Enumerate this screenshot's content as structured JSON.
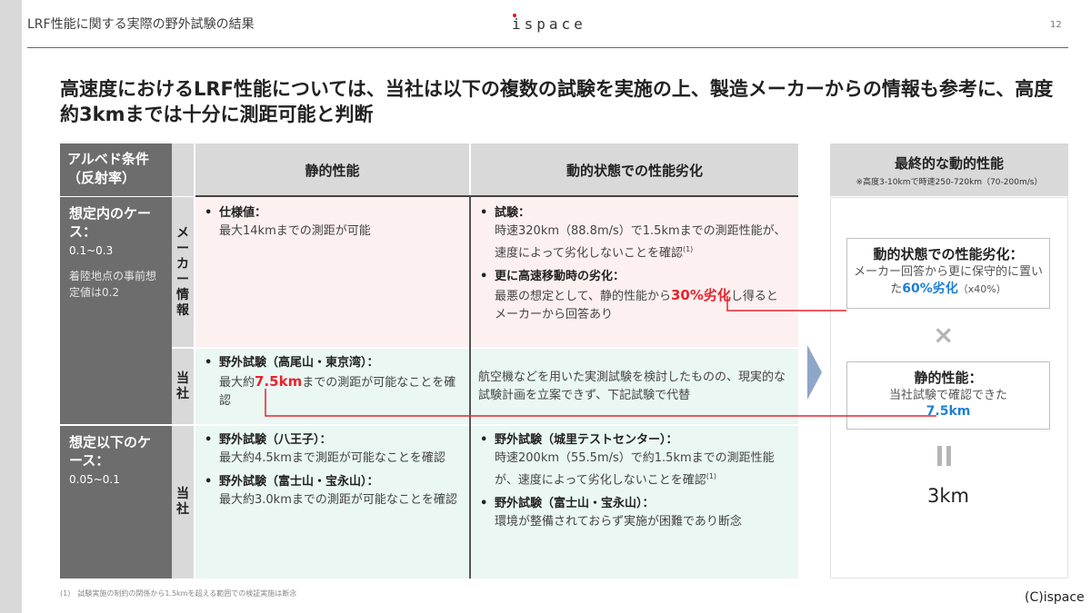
{
  "header": {
    "title": "LRF性能に関する実際の野外試験の結果",
    "logo": "ispace",
    "page": "12"
  },
  "headline": "高速度におけるLRF性能については、当社は以下の複数の試験を実施の上、製造メーカーからの情報も参考に、高度約3kmまでは十分に測距可能と判断",
  "table": {
    "col_albedo": "アルベド条件（反射率）",
    "col_static": "静的性能",
    "col_dynamic": "動的状態での性能劣化",
    "row1": {
      "title": "想定内のケース：",
      "range": "0.1~0.3",
      "note": "着陸地点の事前想定値は0.2",
      "source_maker": "メーカー情報",
      "source_own": "当社"
    },
    "row2": {
      "title": "想定以下のケース：",
      "range": "0.05~0.1",
      "source_own": "当社"
    },
    "maker_static": {
      "title": "仕様値：",
      "body": "最大14kmまでの測距が可能"
    },
    "maker_dynamic_1": {
      "title": "試験：",
      "body": "時速320km（88.8m/s）で1.5kmまでの測距性能が、速度によって劣化しないことを確認",
      "sup": "(1)"
    },
    "maker_dynamic_2": {
      "title": "更に高速移動時の劣化：",
      "body_a": "最悪の想定として、静的性能から",
      "highlight": "30%劣化",
      "body_b": "し得るとメーカーから回答あり"
    },
    "own_static": {
      "title": "野外試験（高尾山・東京湾）：",
      "body_a": "最大約",
      "highlight": "7.5km",
      "body_b": "までの測距が可能なことを確認"
    },
    "own_dynamic": {
      "body": "航空機などを用いた実測試験を検討したものの、現実的な試験計画を立案できず、下記試験で代替"
    },
    "low_static_1": {
      "title": "野外試験（八王子）：",
      "body": "最大約4.5kmまで測距が可能なことを確認"
    },
    "low_static_2": {
      "title": "野外試験（富士山・宝永山）：",
      "body": "最大約3.0kmまでの測距が可能なことを確認"
    },
    "low_dynamic_1": {
      "title": "野外試験（城里テストセンター）：",
      "body": "時速200km（55.5m/s）で約1.5kmまでの測距性能が、速度によって劣化しないことを確認",
      "sup": "(1)"
    },
    "low_dynamic_2": {
      "title": "野外試験（富士山・宝永山）：",
      "body": "環境が整備されておらず実施が困難であり断念"
    }
  },
  "result": {
    "title": "最終的な動的性能",
    "subtitle": "※高度3-10kmで時速250-720km（70-200m/s）",
    "box1_title": "動的状態での性能劣化：",
    "box1_body_a": "メーカー回答から更に保守的に置いた",
    "box1_highlight": "60%劣化",
    "box1_body_b": "（x40%）",
    "multiply": "×",
    "box2_title": "静的性能：",
    "box2_body": "当社試験で確認できた",
    "box2_highlight": "7.5km",
    "equals": "=",
    "final": "3km"
  },
  "footnote": "(1)　試験実施の制約の関係から1.5kmを超える範囲での検証実施は断念",
  "copyright": "(C)ispace",
  "colors": {
    "red": "#e8242d",
    "blue": "#1f7fd6",
    "dark": "#6d6d6d",
    "pink": "#fdf0f0",
    "green": "#eaf7f3"
  }
}
